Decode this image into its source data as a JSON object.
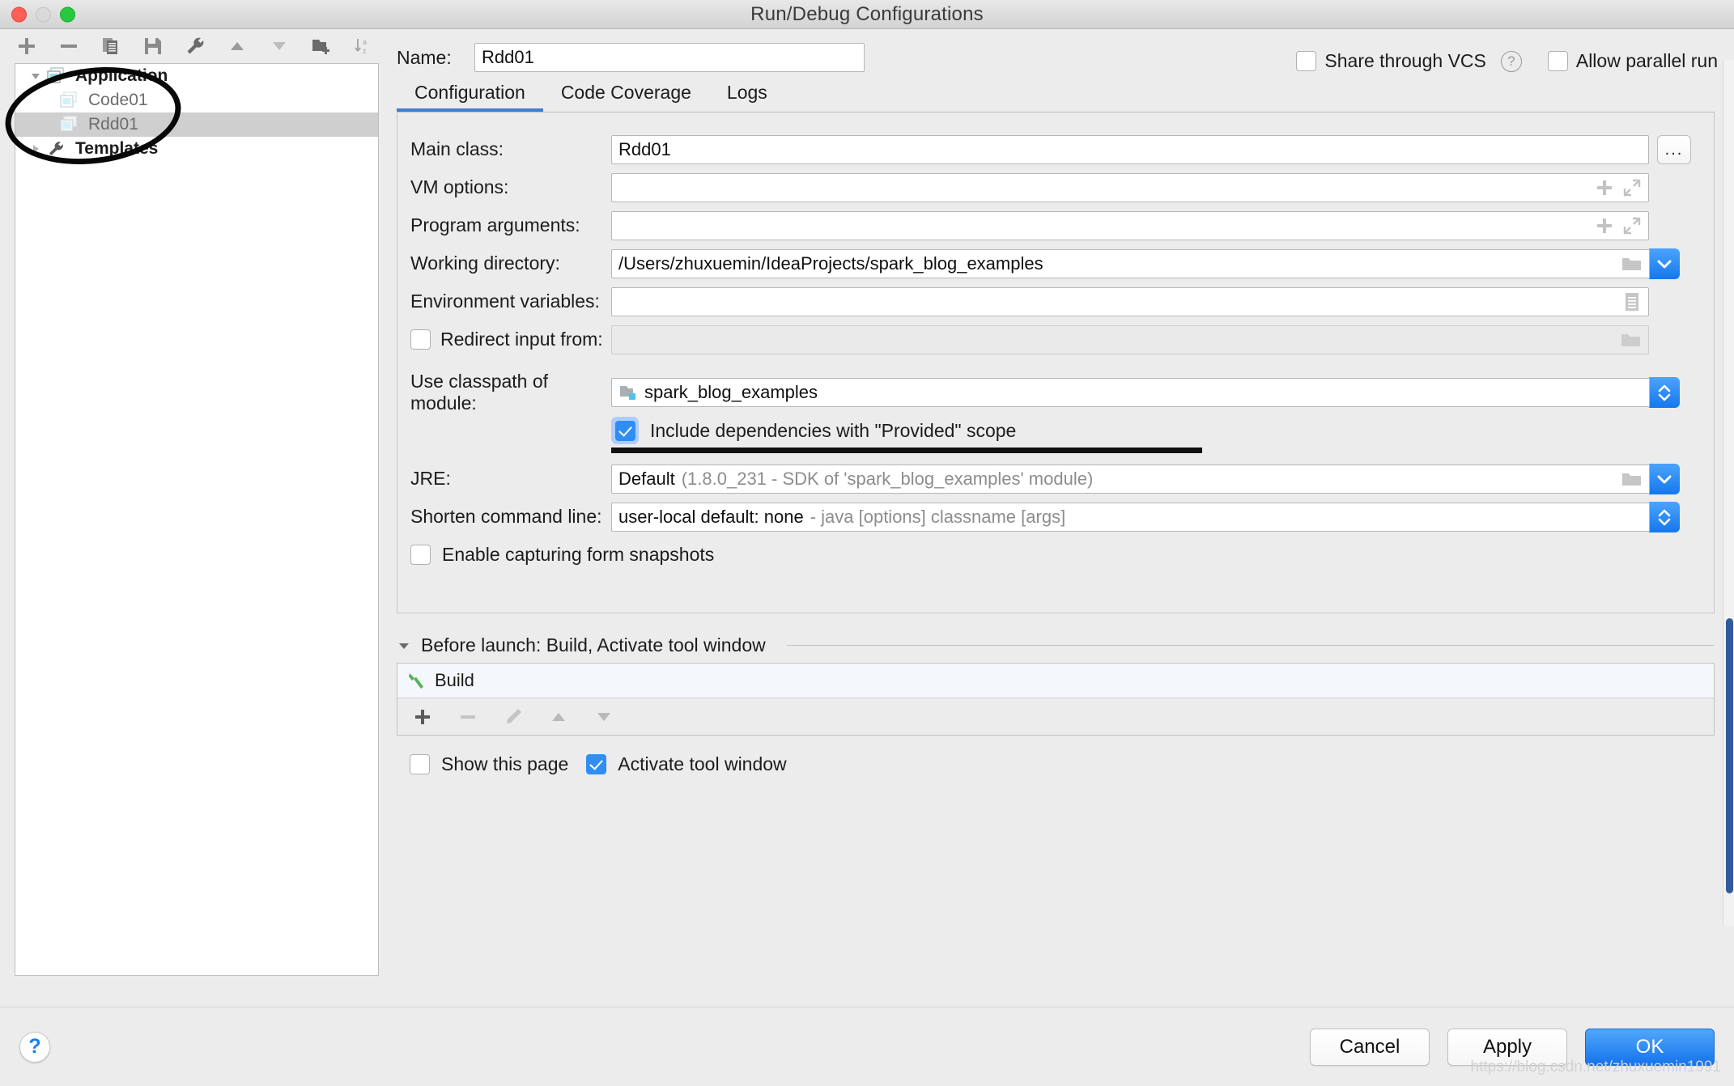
{
  "window": {
    "title": "Run/Debug Configurations",
    "traffic_lights": [
      "close-red",
      "minimize-disabled",
      "maximize-green"
    ]
  },
  "sidebar": {
    "toolbar": [
      {
        "name": "add-configuration-button",
        "icon": "plus-icon"
      },
      {
        "name": "remove-configuration-button",
        "icon": "minus-icon"
      },
      {
        "name": "copy-configuration-button",
        "icon": "copy-icon"
      },
      {
        "name": "save-configuration-button",
        "icon": "save-icon"
      },
      {
        "name": "edit-templates-button",
        "icon": "wrench-icon"
      },
      {
        "name": "move-up-button",
        "icon": "triangle-up-icon"
      },
      {
        "name": "move-down-button",
        "icon": "triangle-down-icon"
      },
      {
        "name": "new-folder-button",
        "icon": "folder-plus-icon"
      },
      {
        "name": "sort-alphabetically-button",
        "icon": "sort-az-icon"
      }
    ],
    "tree": [
      {
        "label": "Application",
        "level": 0,
        "expanded": true,
        "icon": "application-icon",
        "selected": false,
        "bold": true
      },
      {
        "label": "Code01",
        "level": 1,
        "icon": "application-icon",
        "selected": false,
        "bold": false
      },
      {
        "label": "Rdd01",
        "level": 1,
        "icon": "application-icon",
        "selected": true,
        "bold": false
      },
      {
        "label": "Templates",
        "level": 0,
        "expanded": false,
        "icon": "wrench-icon",
        "selected": false,
        "bold": true
      }
    ]
  },
  "header": {
    "name_label": "Name:",
    "name_value": "Rdd01",
    "share_vcs_label": "Share through VCS",
    "share_vcs_checked": false,
    "share_vcs_help": "?",
    "allow_parallel_label": "Allow parallel run",
    "allow_parallel_checked": false
  },
  "tabs": [
    {
      "label": "Configuration",
      "active": true
    },
    {
      "label": "Code Coverage",
      "active": false
    },
    {
      "label": "Logs",
      "active": false
    }
  ],
  "configuration": {
    "main_class": {
      "label": "Main class:",
      "value": "Rdd01",
      "browse_label": "..."
    },
    "vm_options": {
      "label": "VM options:",
      "value": "",
      "placeholder": ""
    },
    "program_arguments": {
      "label": "Program arguments:",
      "value": "",
      "placeholder": ""
    },
    "working_directory": {
      "label": "Working directory:",
      "value": "/Users/zhuxuemin/IdeaProjects/spark_blog_examples"
    },
    "environment_variables": {
      "label": "Environment variables:",
      "value": ""
    },
    "redirect_input": {
      "label": "Redirect input from:",
      "checked": false,
      "value": ""
    },
    "classpath_module": {
      "label": "Use classpath of module:",
      "value": "spark_blog_examples"
    },
    "include_provided": {
      "label": "Include dependencies with \"Provided\" scope",
      "checked": true
    },
    "jre": {
      "label": "JRE:",
      "value": "Default",
      "value_detail": "(1.8.0_231 - SDK of 'spark_blog_examples' module)"
    },
    "shorten_command_line": {
      "label": "Shorten command line:",
      "value": "user-local default: none",
      "value_detail": "- java [options] classname [args]"
    },
    "enable_form_snapshots": {
      "label": "Enable capturing form snapshots",
      "checked": false
    }
  },
  "before_launch": {
    "header": "Before launch: Build, Activate tool window",
    "items": [
      {
        "label": "Build",
        "icon": "hammer-icon"
      }
    ],
    "toolbar": [
      {
        "name": "add-task-button",
        "icon": "plus-icon",
        "enabled": true
      },
      {
        "name": "remove-task-button",
        "icon": "minus-icon",
        "enabled": false
      },
      {
        "name": "edit-task-button",
        "icon": "pencil-icon",
        "enabled": false
      },
      {
        "name": "move-task-up-button",
        "icon": "triangle-up-icon",
        "enabled": false
      },
      {
        "name": "move-task-down-button",
        "icon": "triangle-down-icon",
        "enabled": false
      }
    ],
    "show_this_page": {
      "label": "Show this page",
      "checked": false
    },
    "activate_tool_window": {
      "label": "Activate tool window",
      "checked": true
    }
  },
  "footer": {
    "help_label": "?",
    "cancel_label": "Cancel",
    "apply_label": "Apply",
    "ok_label": "OK",
    "watermark": "https://blog.csdn.net/zhuxuemin1991"
  },
  "colors": {
    "accent_blue": "#1577ef",
    "tab_indicator": "#3f7fcf",
    "checkbox_checked": "#2f8ef5",
    "annotation": "#080808",
    "hammer_green": "#56b356"
  }
}
